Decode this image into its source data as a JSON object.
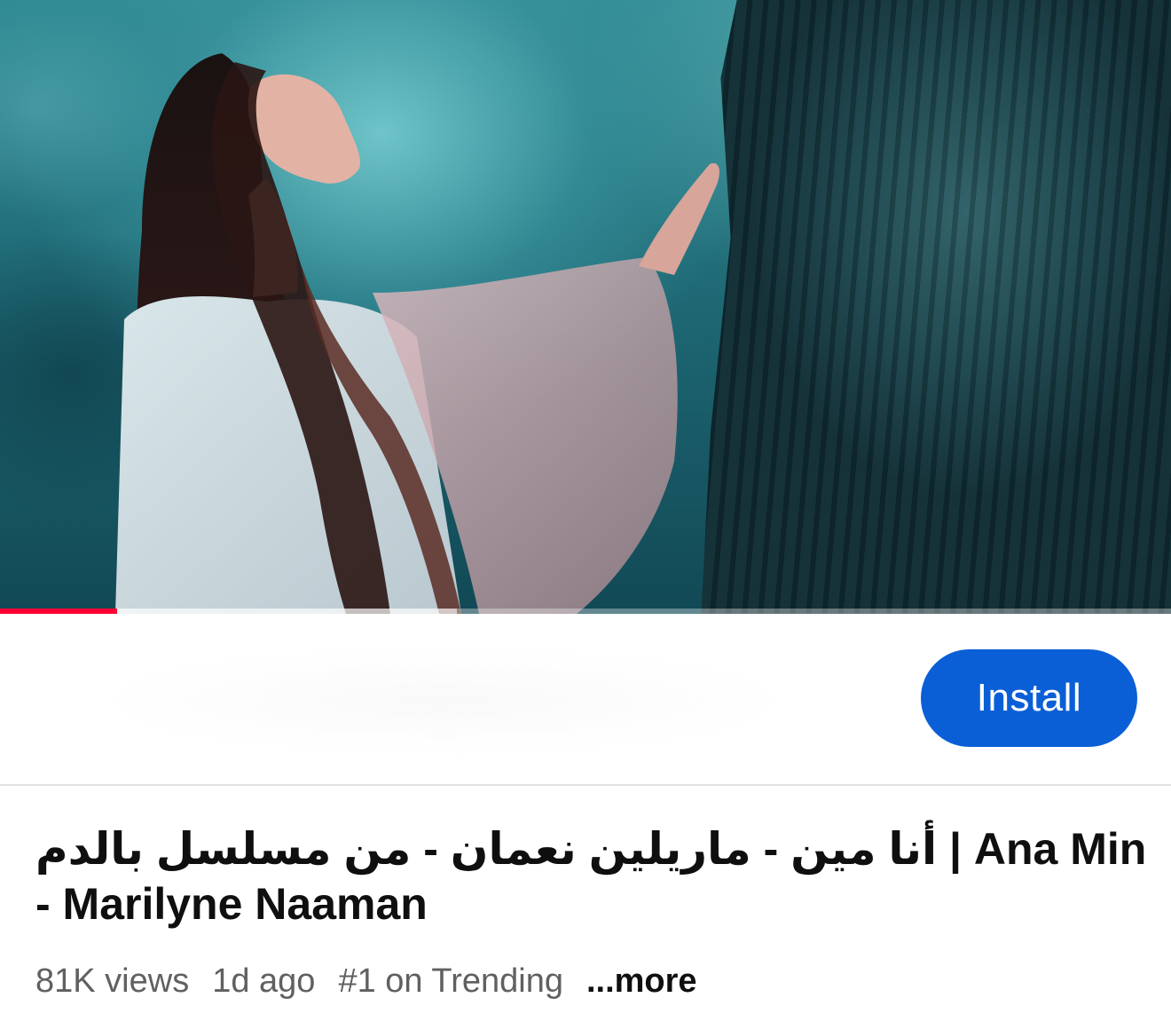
{
  "video": {
    "progress_played": 0.1,
    "progress_buffered": 0.39
  },
  "ad": {
    "install_label": "Install",
    "button_color": "#0b5fd6"
  },
  "title": {
    "line1": "أنا مين - ماريلين نعمان - من مسلسل بالدم | Ana Min",
    "line2": "- Marilyne Naaman"
  },
  "meta": {
    "views": "81K views",
    "age": "1d ago",
    "trending": "#1 on Trending",
    "more_label": "...more"
  },
  "colors": {
    "progress_played": "#ff0033",
    "text_primary": "#0f0f0f",
    "text_secondary": "#606060"
  }
}
